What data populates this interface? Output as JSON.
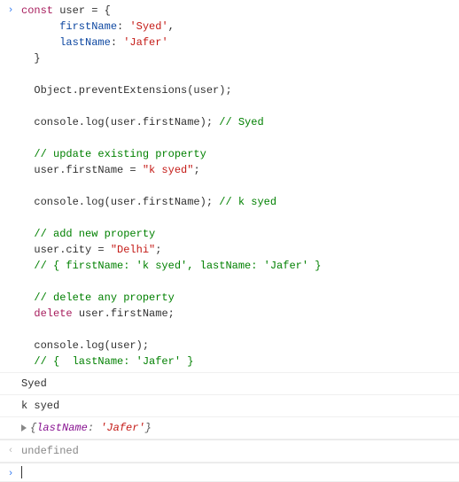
{
  "code": {
    "l1": {
      "a": "const",
      "b": " user = {"
    },
    "l2": {
      "a": "      firstName",
      "b": ": ",
      "c": "'Syed'",
      "d": ","
    },
    "l3": {
      "a": "      lastName",
      "b": ": ",
      "c": "'Jafer'"
    },
    "l4": "  }",
    "l5": "",
    "l6": "  Object.preventExtensions(user);",
    "l7": "",
    "l8a": "  console.log(user.firstName); ",
    "l8b": "// Syed",
    "l9": "",
    "l10": "  // update existing property",
    "l11a": "  user.firstName = ",
    "l11b": "\"k syed\"",
    "l11c": ";",
    "l12": "",
    "l13a": "  console.log(user.firstName); ",
    "l13b": "// k syed",
    "l14": "",
    "l15": "  // add new property",
    "l16a": "  user.city = ",
    "l16b": "\"Delhi\"",
    "l16c": ";",
    "l17": "  // { firstName: 'k syed', lastName: 'Jafer' }",
    "l18": "",
    "l19": "  // delete any property",
    "l20a": "  ",
    "l20b": "delete",
    "l20c": " user.firstName;",
    "l21": "",
    "l22": "  console.log(user);",
    "l23": "  // {  lastName: 'Jafer' }"
  },
  "out1": "Syed",
  "out2": "k syed",
  "obj": {
    "open": "{",
    "key": "lastName",
    "sep": ": ",
    "val": "'Jafer'",
    "close": "}"
  },
  "result": "undefined",
  "chart_data": null
}
